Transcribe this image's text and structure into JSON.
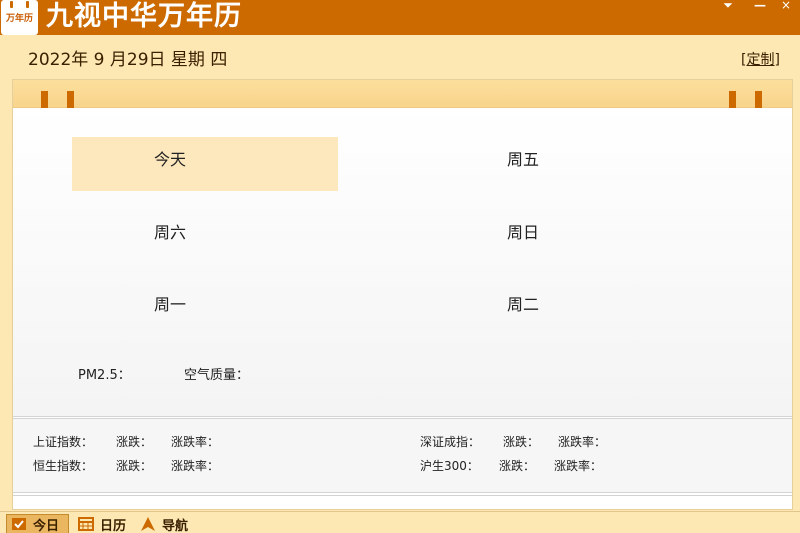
{
  "app": {
    "logo_text": "万年历",
    "title": "九视中华万年历"
  },
  "window_controls": {
    "menu": "⏷",
    "minimize": "—",
    "close": "×"
  },
  "header": {
    "date": "2022年 9 月29日 星期 四",
    "customize": "[定制]"
  },
  "days": {
    "d1": "今天",
    "d2": "周五",
    "d3": "周六",
    "d4": "周日",
    "d5": "周一",
    "d6": "周二"
  },
  "air": {
    "pm25": "PM2.5：",
    "quality": "空气质量："
  },
  "stocks": {
    "sh": "上证指数：",
    "sh_change": "涨跌：",
    "sh_rate": "涨跌率：",
    "sz": "深证成指：",
    "sz_change": "涨跌：",
    "sz_rate": "涨跌率：",
    "hs": "恒生指数：",
    "hs_change": "涨跌：",
    "hs_rate": "涨跌率：",
    "hs300": "沪生300：",
    "hs300_change": "涨跌：",
    "hs300_rate": "涨跌率："
  },
  "tabs": {
    "today": "今日",
    "calendar": "日历",
    "nav": "导航"
  },
  "colors": {
    "brand": "#cc6a00",
    "background": "#fde8b3",
    "highlight": "#fde7bd"
  }
}
